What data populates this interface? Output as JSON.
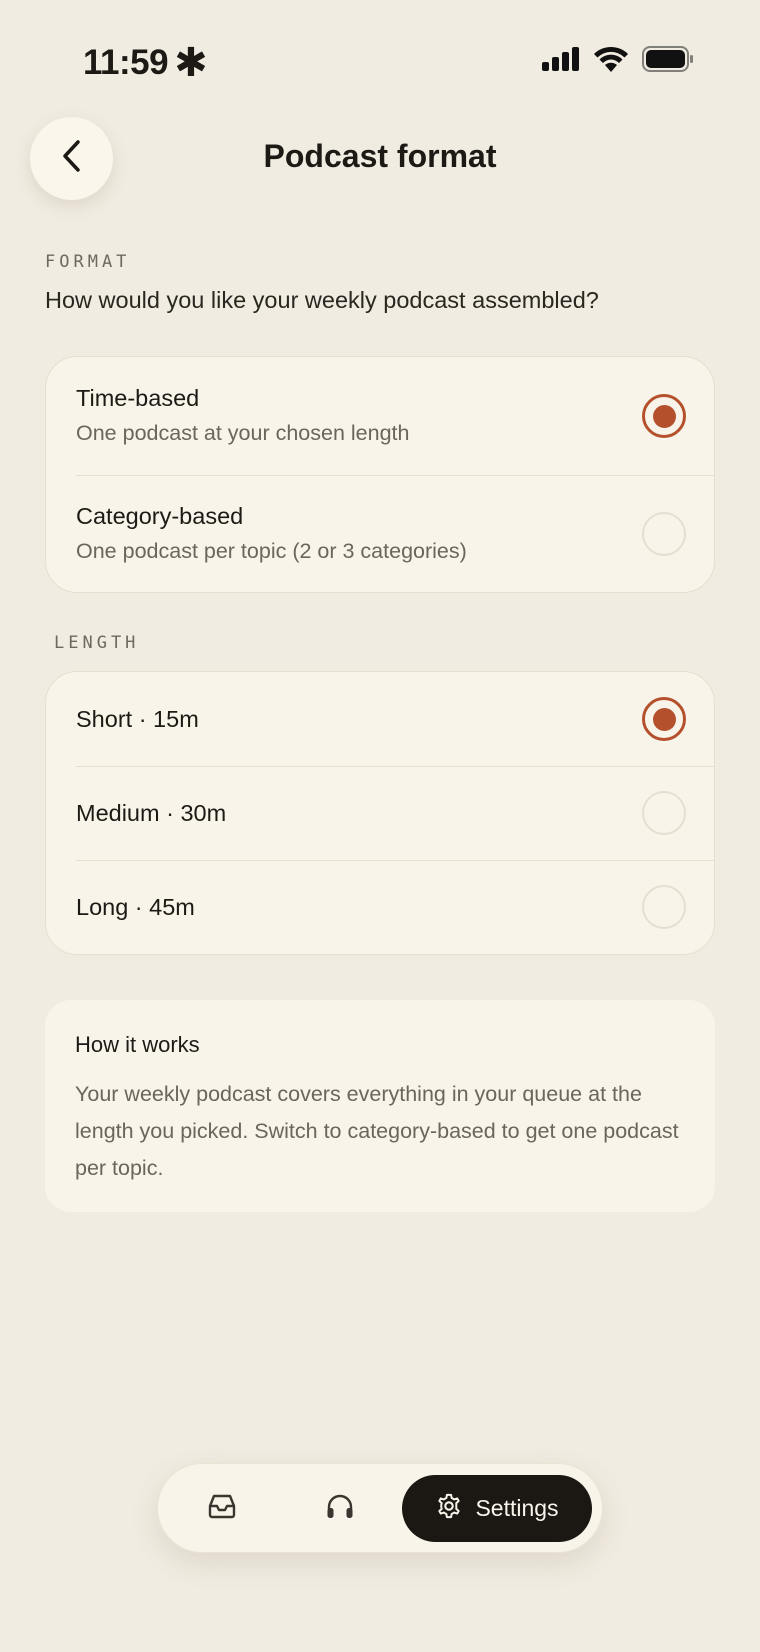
{
  "status_bar": {
    "time": "11:59",
    "time_glyph": "✱",
    "icons": [
      "signal-icon",
      "wifi-icon",
      "battery-icon"
    ]
  },
  "header": {
    "title": "Podcast format",
    "back_icon": "chevron-left-icon"
  },
  "format_section": {
    "label": "FORMAT",
    "question": "How would you like your weekly podcast assembled?",
    "options": [
      {
        "title": "Time-based",
        "subtitle": "One podcast at your chosen length",
        "selected": true
      },
      {
        "title": "Category-based",
        "subtitle": "One podcast per topic (2 or 3 categories)",
        "selected": false
      }
    ]
  },
  "length_section": {
    "label": "LENGTH",
    "options": [
      {
        "label": "Short · 15m",
        "selected": true
      },
      {
        "label": "Medium · 30m",
        "selected": false
      },
      {
        "label": "Long · 45m",
        "selected": false
      }
    ]
  },
  "info": {
    "title": "How it works",
    "body": "Your weekly podcast covers everything in your queue at the length you picked. Switch to category-based to get one podcast per topic."
  },
  "tab_bar": {
    "tabs": [
      {
        "icon": "inbox-icon",
        "active": false
      },
      {
        "icon": "headphones-icon",
        "active": false
      },
      {
        "icon": "gear-icon",
        "label": "Settings",
        "active": true
      }
    ]
  },
  "colors": {
    "background": "#f1ece2",
    "card": "#f8f4ea",
    "accent": "#b4512c",
    "active_tab": "#1b1713"
  }
}
